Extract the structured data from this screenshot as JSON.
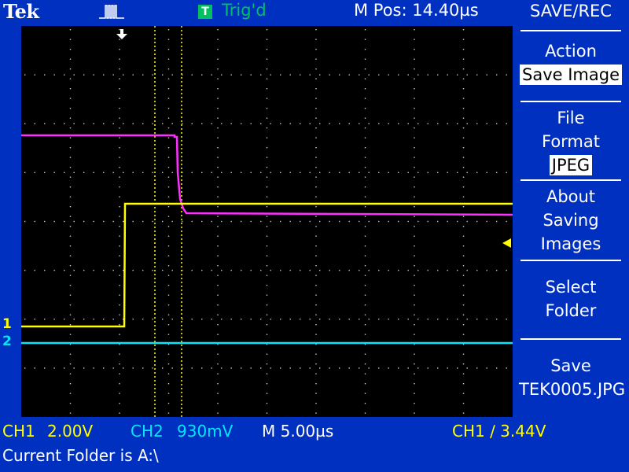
{
  "brand": "Tek",
  "top": {
    "trigger_badge": "T",
    "trigger_status": "Trig'd",
    "mpos": "M Pos: 14.40µs"
  },
  "menu": {
    "title": "SAVE/REC",
    "items": [
      {
        "line1": "Action",
        "line2": "Save Image"
      },
      {
        "line1": "File",
        "line2": "Format",
        "line3": "JPEG"
      },
      {
        "line1": "About",
        "line2": "Saving",
        "line3": "Images"
      },
      {
        "line1": "Select",
        "line2": "Folder"
      },
      {
        "line1": "Save",
        "line2": "TEK0005.JPG"
      }
    ]
  },
  "status": {
    "ch1_label": "CH1",
    "ch1_scale": "2.00V",
    "ch2_label": "CH2",
    "ch2_scale": "930mV",
    "timebase": "M 5.00µs",
    "trigger": "CH1 ∕ 3.44V",
    "folder": "Current Folder is A:\\"
  },
  "markers": {
    "ch1": "1",
    "ch2": "2"
  },
  "colors": {
    "background": "#0030c0",
    "ch1": "#ffff00",
    "ch2": "#00e8ff",
    "math": "#ff30ff",
    "cursor": "#ffff00",
    "trigger": "#00c060"
  }
}
